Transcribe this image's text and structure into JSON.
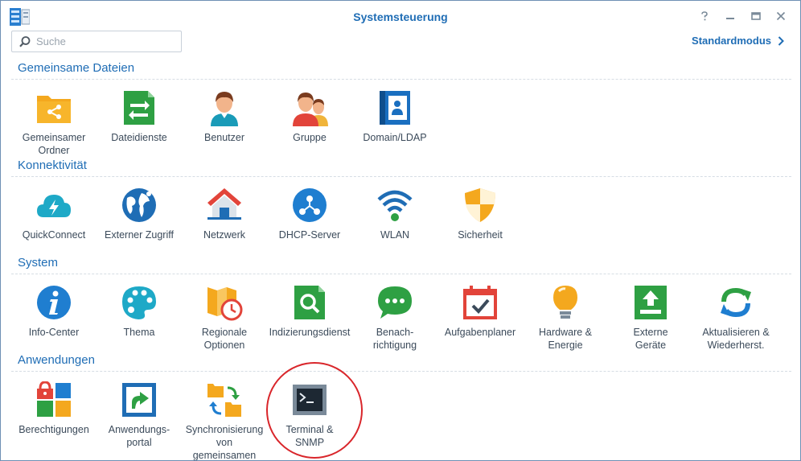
{
  "window": {
    "title": "Systemsteuerung"
  },
  "window_buttons": {
    "help_icon": "help-icon",
    "minimize_icon": "minimize-icon",
    "maximize_icon": "maximize-icon",
    "close_icon": "close-icon"
  },
  "search": {
    "placeholder": "Suche",
    "value": ""
  },
  "mode_link": {
    "label": "Standardmodus",
    "icon": "chevron-right-icon"
  },
  "sections": [
    {
      "title": "Gemeinsame Dateien",
      "items": [
        {
          "label": "Gemeinsamer\nOrdner",
          "icon": "shared-folder-icon"
        },
        {
          "label": "Dateidienste",
          "icon": "file-services-icon"
        },
        {
          "label": "Benutzer",
          "icon": "user-icon"
        },
        {
          "label": "Gruppe",
          "icon": "group-icon"
        },
        {
          "label": "Domain/LDAP",
          "icon": "domain-ldap-icon"
        }
      ]
    },
    {
      "title": "Konnektivität",
      "items": [
        {
          "label": "QuickConnect",
          "icon": "quickconnect-icon"
        },
        {
          "label": "Externer Zugriff",
          "icon": "external-access-icon"
        },
        {
          "label": "Netzwerk",
          "icon": "network-icon"
        },
        {
          "label": "DHCP-Server",
          "icon": "dhcp-server-icon"
        },
        {
          "label": "WLAN",
          "icon": "wifi-icon"
        },
        {
          "label": "Sicherheit",
          "icon": "security-shield-icon"
        }
      ]
    },
    {
      "title": "System",
      "items": [
        {
          "label": "Info-Center",
          "icon": "info-icon"
        },
        {
          "label": "Thema",
          "icon": "palette-icon"
        },
        {
          "label": "Regionale\nOptionen",
          "icon": "regional-clock-icon"
        },
        {
          "label": "Indizierungsdienst",
          "icon": "indexing-icon"
        },
        {
          "label": "Benach-\nrichtigung",
          "icon": "notification-icon"
        },
        {
          "label": "Aufgabenplaner",
          "icon": "task-scheduler-icon"
        },
        {
          "label": "Hardware &\nEnergie",
          "icon": "lightbulb-icon"
        },
        {
          "label": "Externe\nGeräte",
          "icon": "external-devices-icon"
        },
        {
          "label": "Aktualisieren &\nWiederherst.",
          "icon": "update-restore-icon"
        }
      ]
    },
    {
      "title": "Anwendungen",
      "items": [
        {
          "label": "Berechtigungen",
          "icon": "privileges-icon"
        },
        {
          "label": "Anwendungs-\nportal",
          "icon": "application-portal-icon"
        },
        {
          "label": "Synchronisierung\nvon\ngemeinsamen",
          "icon": "sync-shared-folder-icon"
        },
        {
          "label": "Terminal &\nSNMP",
          "icon": "terminal-icon"
        }
      ]
    }
  ],
  "colors": {
    "accent": "#1f6db5",
    "highlight_circle": "#d9262b"
  }
}
